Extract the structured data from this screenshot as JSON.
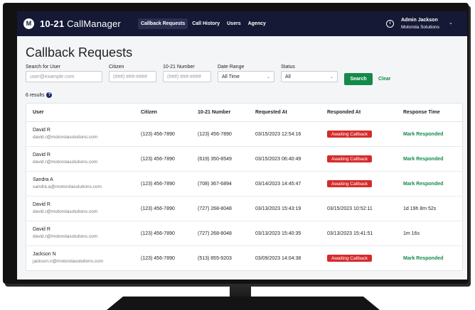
{
  "nav": {
    "logo_glyph": "M",
    "brand_bold": "10-21",
    "brand_rest": "CallManager",
    "links": [
      "Callback Requests",
      "Call History",
      "Users",
      "Agency"
    ],
    "info_glyph": "i",
    "user_name": "Admin Jackson",
    "user_org": "Motorola Solutions",
    "menu_glyph": "⌄"
  },
  "page": {
    "title": "Callback Requests",
    "filters": {
      "user_label": "Search for User",
      "user_placeholder": "user@example.com",
      "citizen_label": "Citizen",
      "citizen_placeholder": "(###) ###-####",
      "number_label": "10-21 Number",
      "number_placeholder": "(###) ###-####",
      "date_label": "Date Range",
      "date_value": "All Time",
      "status_label": "Status",
      "status_value": "All",
      "search_label": "Search",
      "clear_label": "Clear"
    },
    "results_text": "6 results",
    "help_glyph": "?"
  },
  "table": {
    "headers": [
      "User",
      "Citizen",
      "10-21 Number",
      "Requested At",
      "Responded At",
      "Response Time"
    ],
    "rows": [
      {
        "name": "David R",
        "email": "david.r@motorolasolutions.com",
        "citizen": "(123) 456-7890",
        "number": "(123) 456-7890",
        "requested": "03/15/2023 12:54:16",
        "responded": "Awaiting Callback",
        "response": "Mark Responded"
      },
      {
        "name": "David R",
        "email": "david.r@motorolasolutions.com",
        "citizen": "(123) 456-7890",
        "number": "(619) 350-8549",
        "requested": "03/15/2023 06:40:49",
        "responded": "Awaiting Callback",
        "response": "Mark Responded"
      },
      {
        "name": "Sandra A",
        "email": "sandra.a@motorolasolutions.com",
        "citizen": "(123) 456-7890",
        "number": "(708) 367-6894",
        "requested": "03/14/2023 14:45:47",
        "responded": "Awaiting Callback",
        "response": "Mark Responded"
      },
      {
        "name": "David R",
        "email": "david.r@motorolasolutions.com",
        "citizen": "(123) 456-7890",
        "number": "(727) 268-8048",
        "requested": "03/13/2023 15:43:19",
        "responded": "03/15/2023 10:52:11",
        "response": "1d 19h 8m 52s"
      },
      {
        "name": "David R",
        "email": "david.r@motorolasolutions.com",
        "citizen": "(123) 456-7890",
        "number": "(727) 268-8048",
        "requested": "03/13/2023 15:40:35",
        "responded": "03/13/2023 15:41:51",
        "response": "1m 16s"
      },
      {
        "name": "Jackson N",
        "email": "jackson.n@motorolasolutions.com",
        "citizen": "(123) 456-7890",
        "number": "(513) 855-9203",
        "requested": "03/09/2023 14:04:38",
        "responded": "Awaiting Callback",
        "response": "Mark Responded"
      }
    ]
  },
  "colors": {
    "navbar": "#151935",
    "accent_green": "#138a4a",
    "badge_red": "#d62b2b"
  },
  "icons": {
    "logo": "motorola-logo-icon",
    "info": "info-icon",
    "help": "help-icon",
    "chevron": "chevron-down-icon"
  }
}
